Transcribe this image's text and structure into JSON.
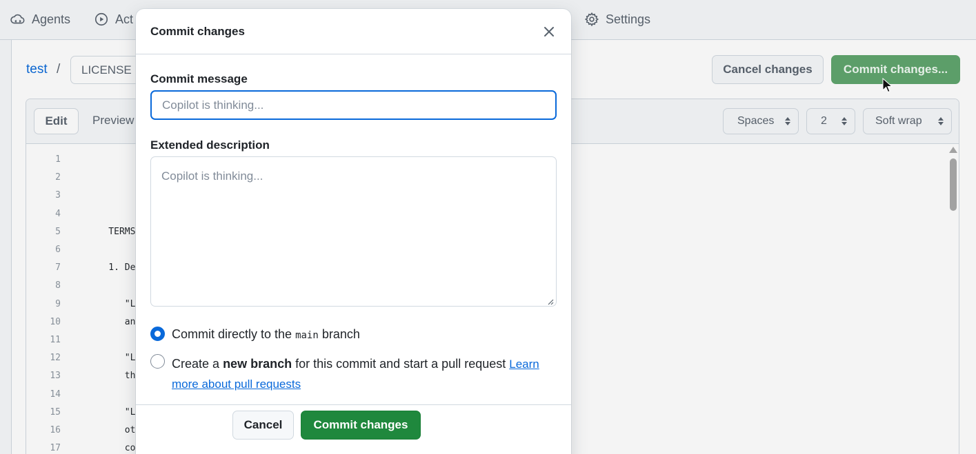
{
  "nav": {
    "agents": "Agents",
    "actions": "Act",
    "settings": "Settings"
  },
  "breadcrumb": {
    "repo": "test",
    "separator": "/",
    "filename": "LICENSE"
  },
  "header_buttons": {
    "cancel": "Cancel changes",
    "commit": "Commit changes..."
  },
  "editor": {
    "tab_edit": "Edit",
    "tab_preview": "Preview",
    "indent_mode": "Spaces",
    "indent_size": "2",
    "wrap_mode": "Soft wrap",
    "line_numbers": [
      "1",
      "2",
      "3",
      "4",
      "5",
      "6",
      "7",
      "8",
      "9",
      "10",
      "11",
      "12",
      "13",
      "14",
      "15",
      "16",
      "17"
    ],
    "code_lines": [
      "",
      "",
      "",
      "",
      "    TERMS",
      "",
      "    1. De",
      "",
      "       \"L",
      "       an",
      "",
      "       \"L",
      "       th",
      "",
      "       \"L",
      "       ot",
      "       co"
    ]
  },
  "modal": {
    "title": "Commit changes",
    "message_label": "Commit message",
    "message_placeholder": "Copilot is thinking...",
    "description_label": "Extended description",
    "description_placeholder": "Copilot is thinking...",
    "option_direct_prefix": "Commit directly to the",
    "option_direct_branch": "main",
    "option_direct_suffix": "branch",
    "option_direct_selected": true,
    "option_new_prefix": "Create a",
    "option_new_bold": "new branch",
    "option_new_suffix": "for this commit and start a pull request",
    "option_new_link_1": "Learn",
    "option_new_link_2": "more about pull requests",
    "cancel_button": "Cancel",
    "commit_button": "Commit changes"
  },
  "colors": {
    "accent_blue": "#0969da",
    "primary_green": "#1f883d",
    "disabled_green": "#5fa56d"
  }
}
